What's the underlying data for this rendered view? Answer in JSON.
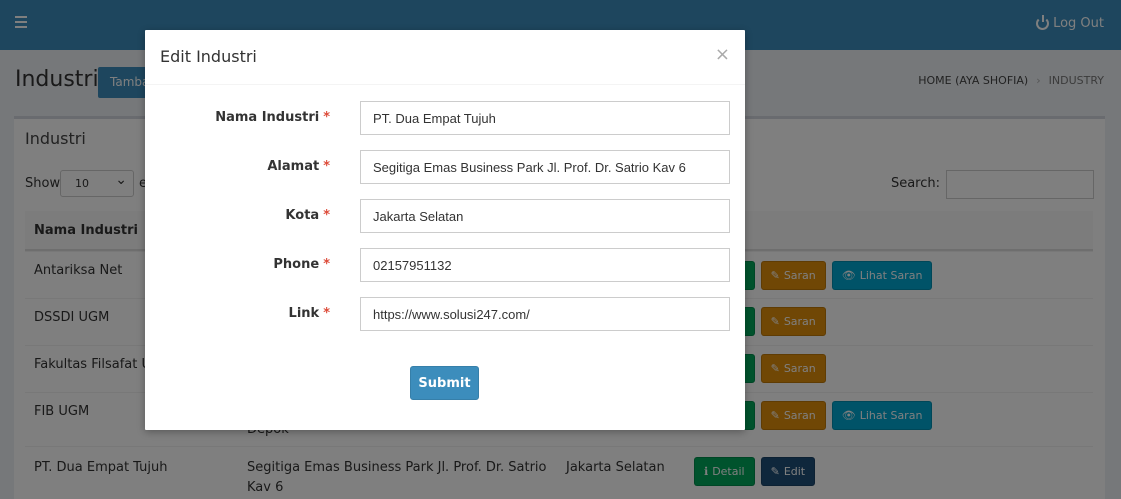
{
  "nav": {
    "logout_label": "Log Out"
  },
  "header": {
    "title": "Industri",
    "add_button": "Tambah",
    "breadcrumb": [
      "HOME (AYA SHOFIA)",
      "INDUSTRY"
    ]
  },
  "box": {
    "title": "Industri",
    "show_label": "Show",
    "page_size": "10",
    "entries_label": "e",
    "search_label": "Search:"
  },
  "table": {
    "headers": [
      "Nama Industri"
    ],
    "rows": [
      {
        "name": "Antariksa Net",
        "alamat": "",
        "kota": ""
      },
      {
        "name": "DSSDI UGM",
        "alamat": "",
        "kota": ""
      },
      {
        "name": "Fakultas Filsafat UG",
        "alamat": "",
        "kota": ""
      },
      {
        "name": "FIB UGM",
        "alamat": "Depok",
        "kota": ""
      },
      {
        "name": "PT. Dua Empat Tujuh",
        "alamat": "Segitiga Emas Business Park Jl. Prof. Dr. Satrio Kav 6",
        "kota": "Jakarta Selatan"
      }
    ],
    "actions": {
      "detail": "Detail",
      "edit": "Edit",
      "saran": "Saran",
      "lihat_saran": "Lihat Saran"
    }
  },
  "modal": {
    "title": "Edit Industri",
    "close": "×",
    "fields": [
      {
        "label": "Nama Industri",
        "value": "PT. Dua Empat Tujuh"
      },
      {
        "label": "Alamat",
        "value": "Segitiga Emas Business Park Jl. Prof. Dr. Satrio Kav 6"
      },
      {
        "label": "Kota",
        "value": "Jakarta Selatan"
      },
      {
        "label": "Phone",
        "value": "02157951132"
      },
      {
        "label": "Link",
        "value": "https://www.solusi247.com/"
      }
    ],
    "required_mark": "*",
    "submit_label": "Submit"
  },
  "colors": {
    "primary": "#3c8dbc",
    "success": "#00a65a",
    "warning": "#e08e0b",
    "info": "#00a7d0",
    "required": "#dd4b39"
  }
}
